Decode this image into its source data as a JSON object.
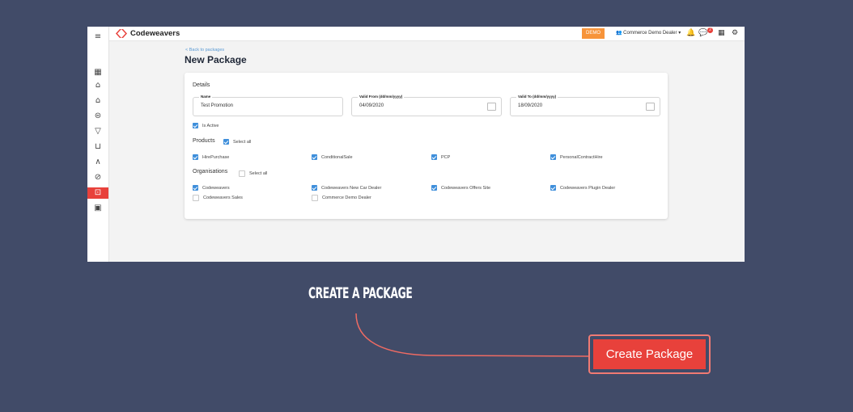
{
  "app": {
    "brand_name": "Codeweavers",
    "brand_color": "#e8413b"
  },
  "topbar": {
    "demo_badge": "DEMO",
    "dealer_label": "Commerce Demo Dealer",
    "notification_count": "2"
  },
  "page": {
    "back_link": "< Back to packages",
    "title": "New Package"
  },
  "details": {
    "heading": "Details",
    "name_label": "Name",
    "name_value": "Test Promotion",
    "valid_from_label": "Valid From (dd/mm/yyyy)",
    "valid_from_value": "04/09/2020",
    "valid_to_label": "Valid To (dd/mm/yyyy)",
    "valid_to_value": "18/09/2020",
    "is_active_label": "Is Active",
    "is_active_checked": true
  },
  "products": {
    "heading": "Products",
    "select_all_label": "Select all",
    "items": [
      {
        "label": "HirePurchase",
        "checked": true
      },
      {
        "label": "ConditionalSale",
        "checked": true
      },
      {
        "label": "PCP",
        "checked": true
      },
      {
        "label": "PersonalContractHire",
        "checked": true
      }
    ]
  },
  "organisations": {
    "heading": "Organisations",
    "select_all_label": "Select all",
    "items": [
      {
        "label": "Codeweavers",
        "checked": true
      },
      {
        "label": "Codeweavers New Car Dealer",
        "checked": true
      },
      {
        "label": "Codeweavers Offers Site",
        "checked": true
      },
      {
        "label": "Codeweavers Plugin Dealer",
        "checked": true
      },
      {
        "label": "Codeweavers Sales",
        "checked": false
      },
      {
        "label": "Commerce Demo Dealer",
        "checked": false
      }
    ]
  },
  "tutorial": {
    "caption": "Create a package",
    "button_label": "Create Package"
  }
}
